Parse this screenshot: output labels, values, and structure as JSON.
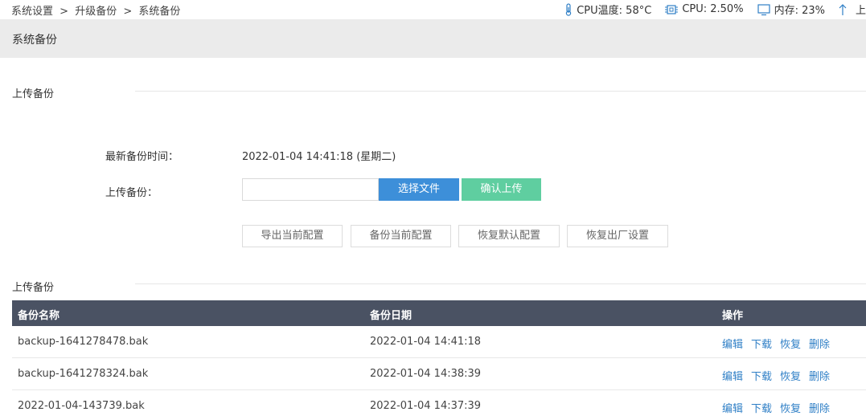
{
  "breadcrumb": {
    "item1": "系统设置",
    "sep1": ">",
    "item2": "升级备份",
    "sep2": ">",
    "item3": "系统备份"
  },
  "status": {
    "cpu_temp": "CPU温度: 58°C",
    "cpu": "CPU: 2.50%",
    "memory": "内存: 23%",
    "extra": "上"
  },
  "page": {
    "title": "系统备份"
  },
  "upload_section": {
    "title": "上传备份",
    "latest_label": "最新备份时间：",
    "latest_value": "2022-01-04 14:41:18 (星期二)",
    "upload_label": "上传备份：",
    "file_placeholder": "",
    "choose_file": "选择文件",
    "confirm_upload": "确认上传"
  },
  "actions": {
    "export": "导出当前配置",
    "backup": "备份当前配置",
    "restore_default": "恢复默认配置",
    "factory_reset": "恢复出厂设置"
  },
  "list_section": {
    "title": "上传备份"
  },
  "table": {
    "headers": {
      "name": "备份名称",
      "date": "备份日期",
      "ops": "操作"
    },
    "op_labels": {
      "edit": "编辑",
      "download": "下载",
      "restore": "恢复",
      "delete": "删除"
    },
    "rows": [
      {
        "name": "backup-1641278478.bak",
        "date": "2022-01-04 14:41:18"
      },
      {
        "name": "backup-1641278324.bak",
        "date": "2022-01-04 14:38:39"
      },
      {
        "name": "2022-01-04-143739.bak",
        "date": "2022-01-04 14:37:39"
      }
    ]
  },
  "colors": {
    "header_bg": "#4a5263",
    "primary": "#3d8fd9",
    "success": "#5fcea0",
    "link": "#2f7fc6",
    "status_icon": "#2f7fc6"
  },
  "icons": {
    "temp": "thermometer-icon",
    "cpu": "cpu-chip-icon",
    "memory": "monitor-icon",
    "upload": "arrow-up-icon"
  }
}
